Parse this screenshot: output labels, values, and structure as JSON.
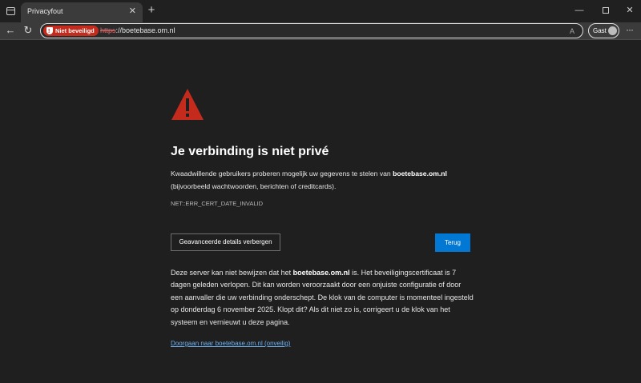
{
  "colors": {
    "error_red": "#c42b1c",
    "link_blue": "#6fb1ee",
    "button_blue": "#0078d4",
    "background": "#1f1f1f"
  },
  "tab": {
    "title": "Privacyfout",
    "close_icon": "close-icon",
    "new_tab_symbol": "+"
  },
  "window_controls": {
    "minimize": "—",
    "close": "✕"
  },
  "toolbar": {
    "back": "←",
    "reload": "↻",
    "security_badge": "Niet beveiligd",
    "url_protocol": "https",
    "url_rest": "://boetebase.om.nl",
    "read_aloud": "A",
    "guest_label": "Gast",
    "more": "···"
  },
  "page": {
    "heading": "Je verbinding is niet privé",
    "desc_prefix": "Kwaadwillende gebruikers proberen mogelijk uw gegevens te stelen van ",
    "desc_domain": "boetebase.om.nl",
    "desc_suffix": " (bijvoorbeeld wachtwoorden, berichten of creditcards).",
    "error_code": "NET::ERR_CERT_DATE_INVALID",
    "advanced_button": "Geavanceerde details verbergen",
    "back_button": "Terug",
    "detail_prefix": "Deze server kan niet bewijzen dat het ",
    "detail_domain": "boetebase.om.nl",
    "detail_suffix": " is. Het beveiligingscertificaat is 7 dagen geleden verlopen. Dit kan worden veroorzaakt door een onjuiste configuratie of door een aanvaller die uw verbinding onderschept. De klok van de computer is momenteel ingesteld op donderdag 6 november 2025. Klopt dit? Als dit niet zo is, corrigeert u de klok van het systeem en vernieuwt u deze pagina.",
    "proceed_link": "Doorgaan naar boetebase.om.nl (onveilig)"
  }
}
